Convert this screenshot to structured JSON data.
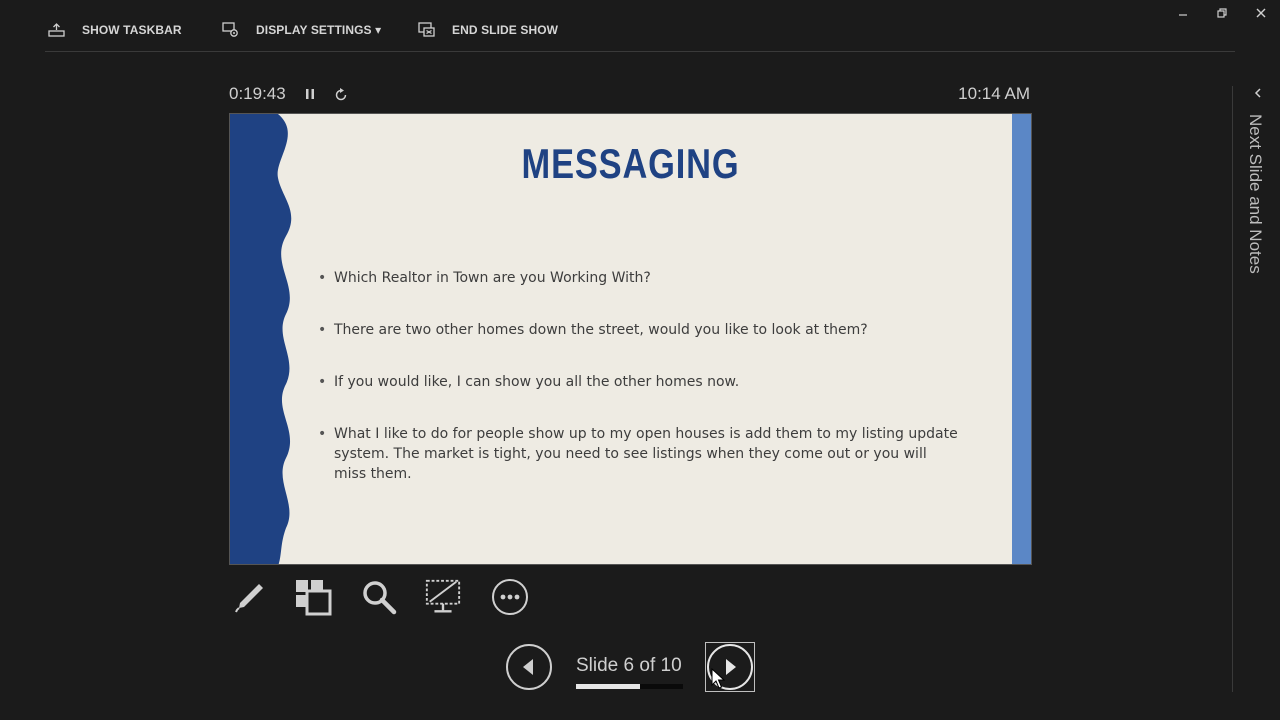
{
  "toolbar": {
    "show_taskbar": "SHOW TASKBAR",
    "display_settings": "DISPLAY SETTINGS ▾",
    "end_slide_show": "END SLIDE SHOW"
  },
  "window": {
    "minimize_icon": "minimize-icon",
    "restore_icon": "restore-icon",
    "close_icon": "close-icon"
  },
  "presenter": {
    "elapsed_time": "0:19:43",
    "clock": "10:14 AM",
    "side_panel_label": "Next Slide and Notes"
  },
  "slide": {
    "title": "MESSAGING",
    "bullets": [
      "Which Realtor in Town are you Working With?",
      "There are two other homes down the street, would you like to look at them?",
      "If you would like, I can show you all the other homes now.",
      "What I like to do for people show up to my open houses is add them to my listing update system. The market is tight, you need to see listings when they come out or you will miss them."
    ]
  },
  "navigation": {
    "counter": "Slide 6 of 10",
    "current": 6,
    "total": 10,
    "progress_fraction": 0.6
  },
  "colors": {
    "background": "#1b1b1b",
    "slide_bg": "#eeebe3",
    "slide_accent_dark": "#1f4283",
    "slide_accent_light": "#5b87c6",
    "ui_text": "#d6d6d6"
  }
}
